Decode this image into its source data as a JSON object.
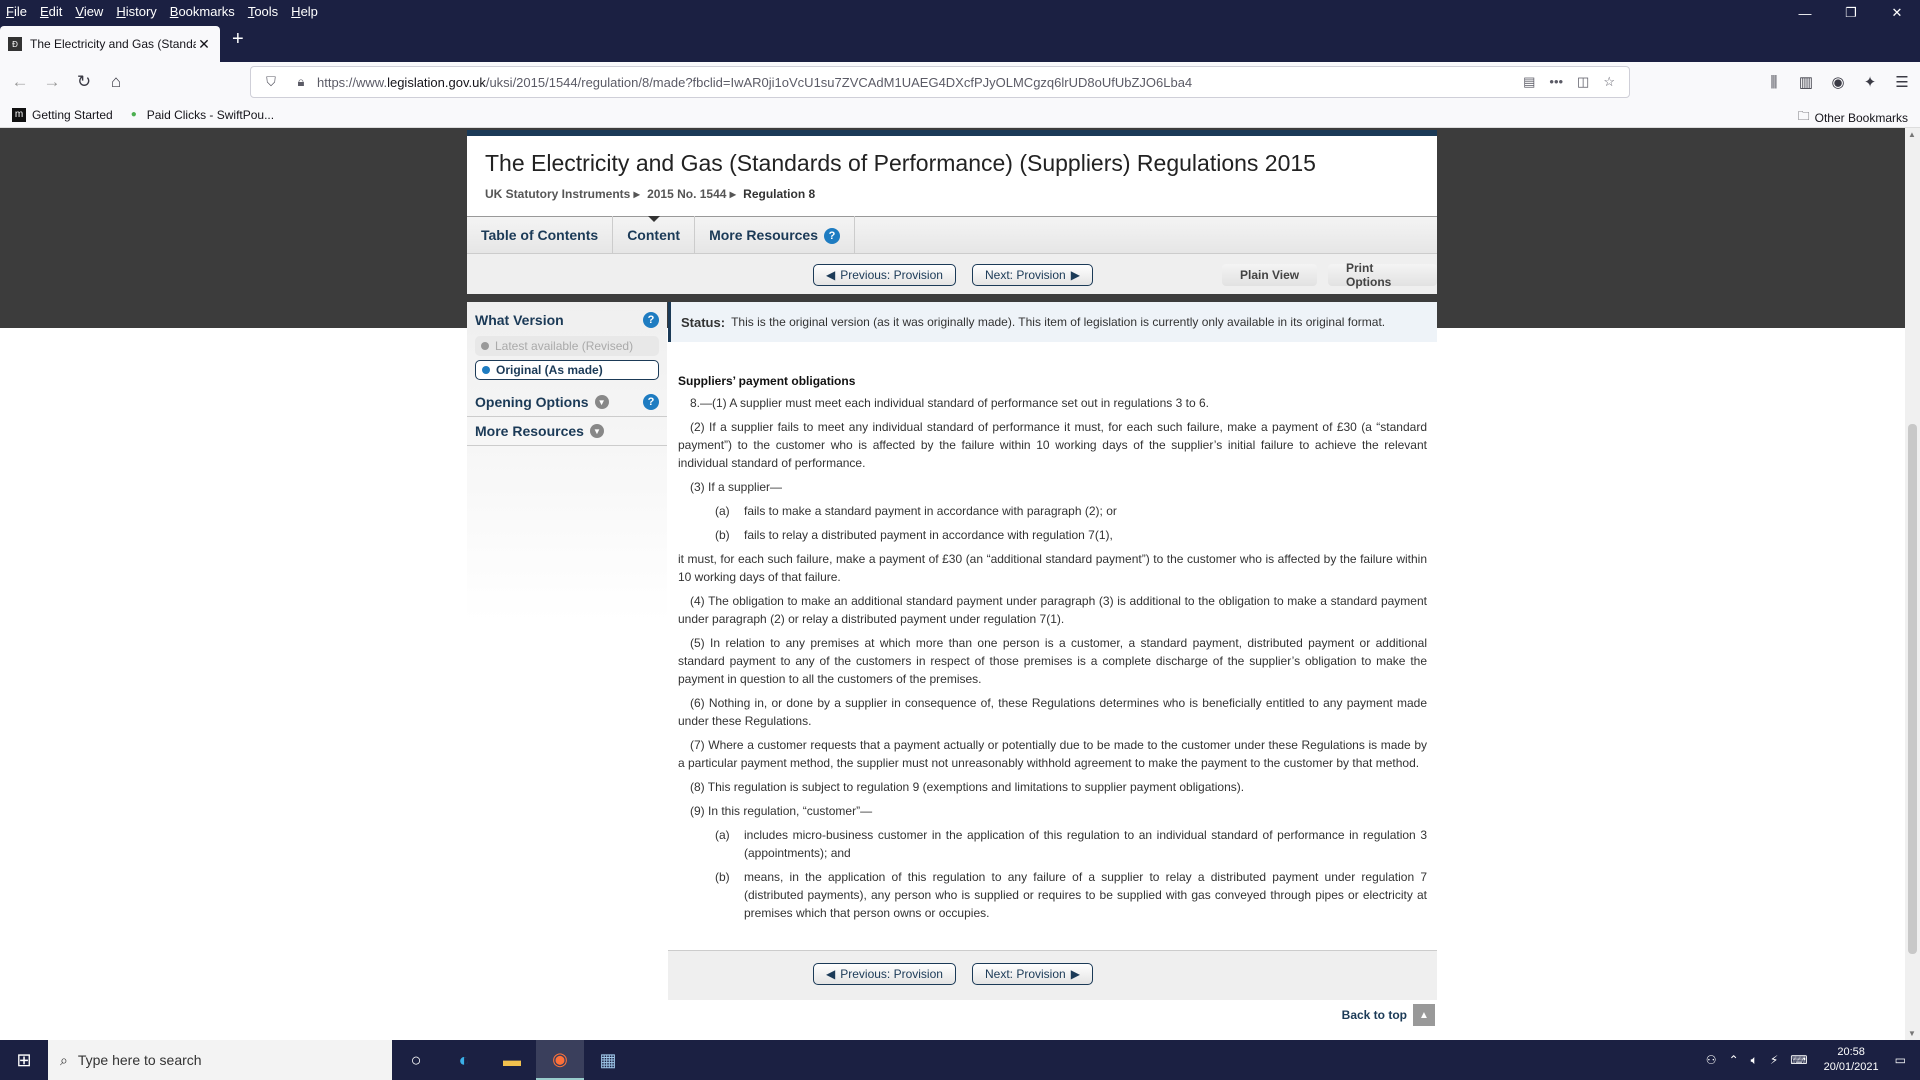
{
  "menu": [
    "File",
    "Edit",
    "View",
    "History",
    "Bookmarks",
    "Tools",
    "Help"
  ],
  "window_controls": {
    "minimize": "—",
    "restore": "❐",
    "close": "✕"
  },
  "tab": {
    "title": "The Electricity and Gas (Standa",
    "favicon": "Ð",
    "close": "✕"
  },
  "newtab": "+",
  "nav": {
    "back": "←",
    "forward": "→",
    "reload": "↻",
    "home": "⌂"
  },
  "url": {
    "prefix": "https://www.",
    "host": "legislation.gov.uk",
    "path": "/uksi/2015/1544/regulation/8/made?fbclid=IwAR0ji1oVcU1su7ZVCAdM1UAEG4DXcfPJyOLMCgzq6lrUD8oUfUbZJO6Lba4"
  },
  "bookmarks": [
    {
      "label": "Getting Started",
      "icon": "m"
    },
    {
      "label": "Paid Clicks - SwiftPou...",
      "icon": "●"
    }
  ],
  "other_bookmarks": "Other Bookmarks",
  "leg": {
    "title": "The Electricity and Gas (Standards of Performance) (Suppliers) Regulations 2015",
    "breadcrumbs": [
      "UK Statutory Instruments ▸",
      "2015 No. 1544 ▸",
      "Regulation 8"
    ],
    "tabs": [
      "Table of Contents",
      "Content",
      "More Resources"
    ],
    "prev": "Previous: Provision",
    "next": "Next: Provision",
    "plain_view": "Plain View",
    "print_options": "Print Options",
    "what_version": "What Version",
    "latest": "Latest available (Revised)",
    "original": "Original (As made)",
    "opening_options": "Opening Options",
    "more_resources": "More Resources",
    "status_label": "Status:",
    "status_text": "This is the original version (as it was originally made). This item of legislation is currently only available in its original format.",
    "heading": "Suppliers’ payment obligations",
    "p1": "8.—(1) A supplier must meet each individual standard of performance set out in regulations 3 to 6.",
    "p2": "(2) If a supplier fails to meet any individual standard of performance it must, for each such failure, make a payment of £30 (a “standard payment”) to the customer who is affected by the failure within 10 working days of the supplier’s initial failure to achieve the relevant individual standard of performance.",
    "p3": "(3) If a supplier—",
    "p3a_l": "(a)",
    "p3a": "fails to make a standard payment in accordance with paragraph (2); or",
    "p3b_l": "(b)",
    "p3b": "fails to relay a distributed payment in accordance with regulation 7(1),",
    "p3c": "it must, for each such failure, make a payment of £30 (an “additional standard payment”) to the customer who is affected by the failure within 10 working days of that failure.",
    "p4": "(4) The obligation to make an additional standard payment under paragraph (3) is additional to the obligation to make a standard payment under paragraph (2) or relay a distributed payment under regulation 7(1).",
    "p5": "(5) In relation to any premises at which more than one person is a customer, a standard payment, distributed payment or additional standard payment to any of the customers in respect of those premises is a complete discharge of the supplier’s obligation to make the payment in question to all the customers of the premises.",
    "p6": "(6) Nothing in, or done by a supplier in consequence of, these Regulations determines who is beneficially entitled to any payment made under these Regulations.",
    "p7": "(7) Where a customer requests that a payment actually or potentially due to be made to the customer under these Regulations is made by a particular payment method, the supplier must not unreasonably withhold agreement to make the payment to the customer by that method.",
    "p8": "(8) This regulation is subject to regulation 9 (exemptions and limitations to supplier payment obligations).",
    "p9": "(9) In this regulation, “customer”—",
    "p9a_l": "(a)",
    "p9a": "includes micro-business customer in the application of this regulation to an individual standard of performance in regulation 3 (appointments); and",
    "p9b_l": "(b)",
    "p9b": "means, in the application of this regulation to any failure of a supplier to relay a distributed payment under regulation 7 (distributed payments), any person who is supplied or requires to be supplied with gas conveyed through pipes or electricity at premises which that person owns or occupies.",
    "back_to_top": "Back to top"
  },
  "taskbar": {
    "search_placeholder": "Type here to search",
    "time": "20:58",
    "date": "20/01/2021"
  },
  "colors": {
    "nav_dark": "#1b3a57",
    "browser_chrome": "#1b2042",
    "help_blue": "#1e7cc1"
  }
}
